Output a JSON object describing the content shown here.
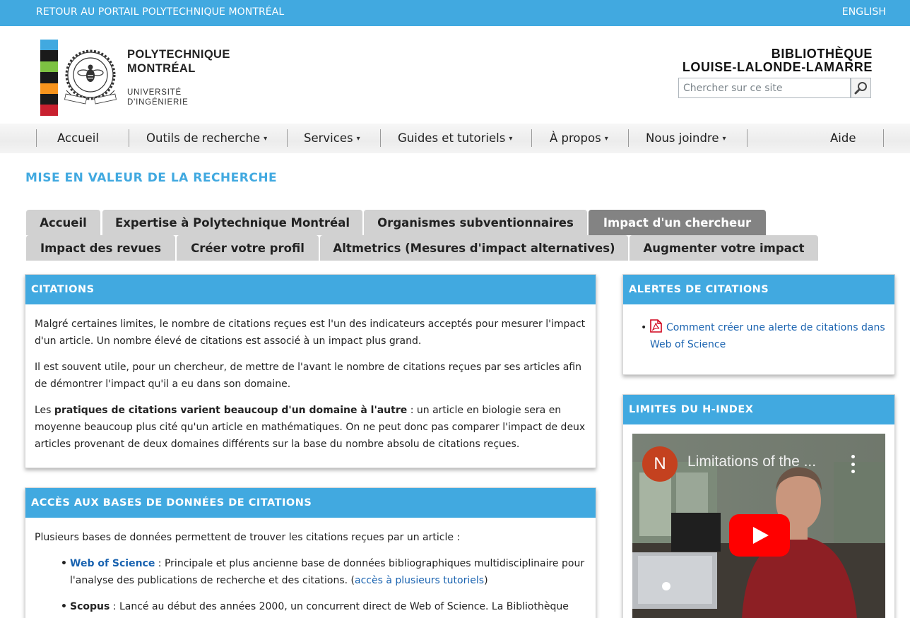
{
  "topbar": {
    "portal_link": "RETOUR AU PORTAIL POLYTECHNIQUE MONTRÉAL",
    "language_link": "ENGLISH"
  },
  "header": {
    "brand_name": "POLYTECHNIQUE\nMONTRÉAL",
    "brand_sub": "UNIVERSITÉ\nD'INGÉNIERIE",
    "library_name": "BIBLIOTHÈQUE\nLOUISE-LALONDE-LAMARRE",
    "search_placeholder": "Chercher sur ce site",
    "logo_colors": [
      "#41a9e0",
      "#1a1a1a",
      "#7dc242",
      "#1a1a1a",
      "#f7941d",
      "#1a1a1a",
      "#c8202f"
    ]
  },
  "nav": {
    "items": [
      {
        "label": "Accueil",
        "has_menu": false
      },
      {
        "label": "Outils de recherche",
        "has_menu": true
      },
      {
        "label": "Services",
        "has_menu": true
      },
      {
        "label": "Guides et tutoriels",
        "has_menu": true
      },
      {
        "label": "À propos",
        "has_menu": true
      },
      {
        "label": "Nous joindre",
        "has_menu": true
      },
      {
        "label": "Aide",
        "has_menu": false
      }
    ]
  },
  "page_title": "MISE EN VALEUR DE LA RECHERCHE",
  "tabs": {
    "row1": [
      "Accueil",
      "Expertise à Polytechnique Montréal",
      "Organismes subventionnaires",
      "Impact d'un chercheur"
    ],
    "row2": [
      "Impact des revues",
      "Créer votre profil",
      "Altmetrics (Mesures d'impact alternatives)",
      "Augmenter votre impact"
    ],
    "active": "Impact d'un chercheur"
  },
  "citations": {
    "heading": "CITATIONS",
    "p1": "Malgré certaines limites, le nombre de citations reçues est l'un des indicateurs acceptés pour mesurer l'impact d'un article. Un nombre élevé de citations est associé à un impact plus grand.",
    "p2": "Il est souvent utile, pour un chercheur, de mettre de l'avant le nombre de citations reçues par ses articles afin de démontrer l'impact qu'il a eu dans son domaine.",
    "p3_prefix": "Les ",
    "p3_bold": "pratiques de citations varient beaucoup d'un domaine à l'autre",
    "p3_rest": " : un article en biologie sera en moyenne beaucoup plus cité qu'un article en mathématiques. On ne peut donc pas comparer l'impact de deux articles provenant de deux domaines différents sur la base du nombre absolu de citations reçues."
  },
  "databases": {
    "heading": "ACCÈS AUX BASES DE DONNÉES DE CITATIONS",
    "intro": "Plusieurs bases de données permettent de trouver les citations reçues par un article :",
    "wos_label": "Web of Science",
    "wos_text": " : Principale et plus ancienne base de données bibliographiques multidisciplinaire pour l'analyse des publications de recherche et des citations. (",
    "wos_link": "accès à plusieurs tutoriels",
    "wos_close": ")",
    "scopus_label": "Scopus",
    "scopus_text": " : Lancé au début des années 2000, un concurrent direct de Web of Science. La Bibliothèque"
  },
  "alerts": {
    "heading": "ALERTES DE CITATIONS",
    "link": "Comment créer une alerte de citations dans Web of Science"
  },
  "hindex": {
    "heading": "LIMITES DU H-INDEX",
    "video_title": "Limitations of the ...",
    "channel_initial": "N"
  }
}
